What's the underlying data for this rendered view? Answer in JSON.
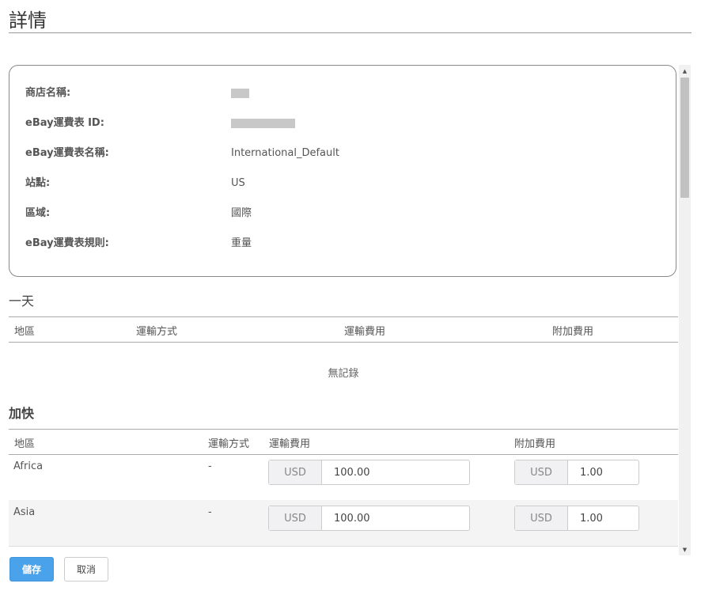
{
  "page": {
    "title": "詳情"
  },
  "info": {
    "rows": [
      {
        "label": "商店名稱:",
        "value": ""
      },
      {
        "label": "eBay運費表 ID:",
        "value": ""
      },
      {
        "label": "eBay運費表名稱:",
        "value": "International_Default"
      },
      {
        "label": "站點:",
        "value": "US"
      },
      {
        "label": "區域:",
        "value": "國際"
      },
      {
        "label": "eBay運費表規則:",
        "value": "重量"
      }
    ]
  },
  "one_day": {
    "title": "一天",
    "headers": [
      "地區",
      "運輸方式",
      "運輸費用",
      "附加費用"
    ],
    "empty_text": "無記錄"
  },
  "expedited": {
    "title": "加快",
    "headers": [
      "地區",
      "運輸方式",
      "運輸費用",
      "附加費用"
    ],
    "rows": [
      {
        "region": "Africa",
        "method": "-",
        "ship_currency": "USD",
        "ship_amount": "100.00",
        "extra_currency": "USD",
        "extra_amount": "1.00"
      },
      {
        "region": "Asia",
        "method": "-",
        "ship_currency": "USD",
        "ship_amount": "100.00",
        "extra_currency": "USD",
        "extra_amount": "1.00"
      }
    ]
  },
  "actions": {
    "save": "儲存",
    "cancel": "取消"
  },
  "colors": {
    "primary": "#4aa3ea",
    "row_alt": "#f4f4f4"
  },
  "icons": {
    "scroll_up": "triangle-up",
    "scroll_down": "triangle-down"
  }
}
